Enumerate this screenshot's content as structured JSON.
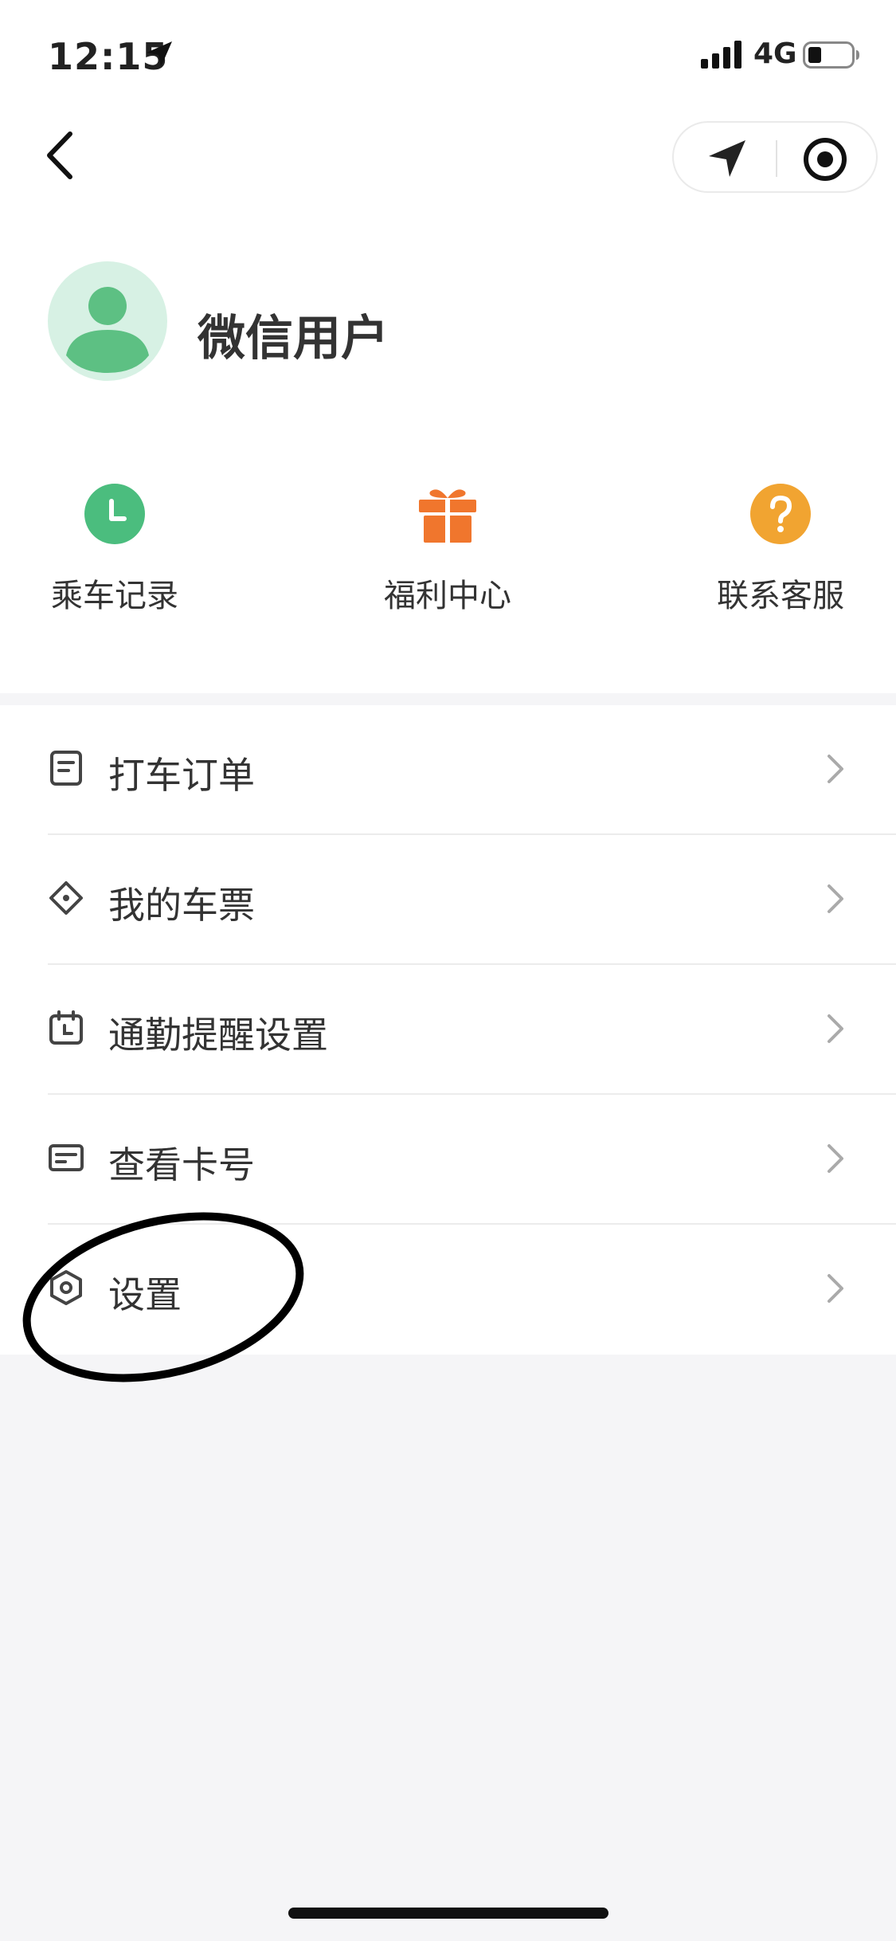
{
  "status_bar": {
    "time": "12:15",
    "network": "4G"
  },
  "profile": {
    "username": "微信用户"
  },
  "quick_actions": [
    {
      "label": "乘车记录",
      "icon": "clock-icon",
      "color": "#4bbd7e"
    },
    {
      "label": "福利中心",
      "icon": "gift-icon",
      "color": "#f0762d"
    },
    {
      "label": "联系客服",
      "icon": "question-icon",
      "color": "#f1a431"
    }
  ],
  "menu": [
    {
      "label": "打车订单",
      "icon": "order-icon"
    },
    {
      "label": "我的车票",
      "icon": "ticket-icon"
    },
    {
      "label": "通勤提醒设置",
      "icon": "calendar-clock-icon"
    },
    {
      "label": "查看卡号",
      "icon": "card-icon"
    },
    {
      "label": "设置",
      "icon": "settings-hexagon-icon"
    }
  ]
}
